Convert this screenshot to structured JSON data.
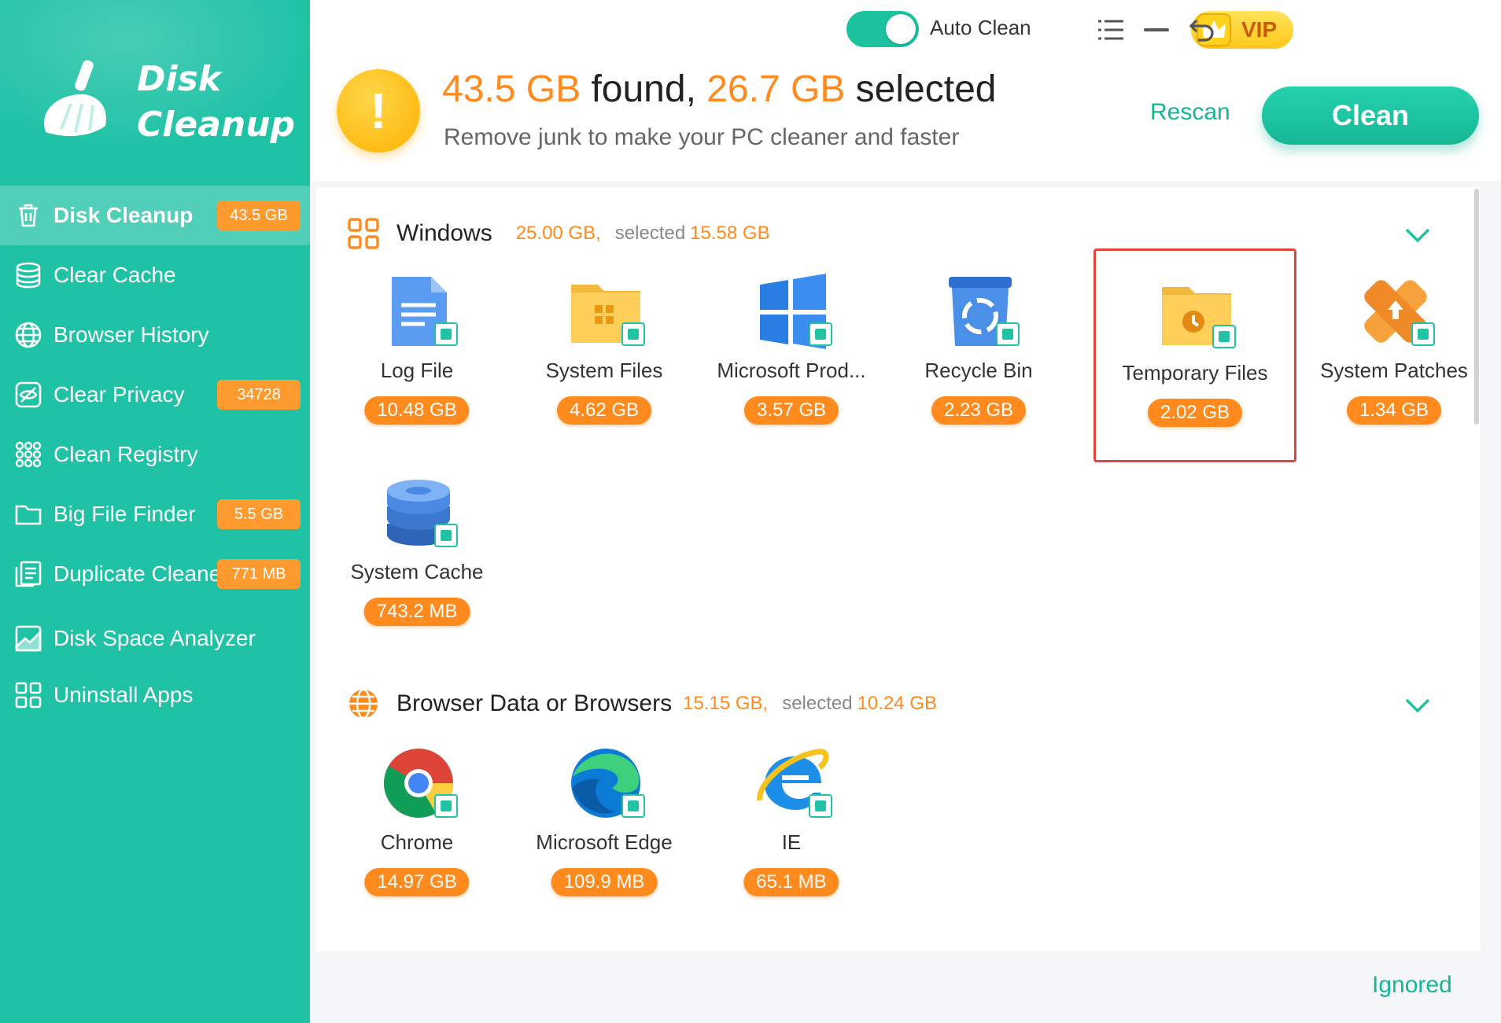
{
  "app": {
    "name_line1": "Disk",
    "name_line2": "Cleanup"
  },
  "colors": {
    "sidebar_bg": "#20c2a6",
    "accent_green": "#1cc29e",
    "orange": "#ff8a1e",
    "selection_border": "#e0463a"
  },
  "sidebar": {
    "items": [
      {
        "label": "Disk Cleanup",
        "badge": "43.5 GB",
        "icon": "trash-icon",
        "active": true
      },
      {
        "label": "Clear Cache",
        "badge": "",
        "icon": "database-icon"
      },
      {
        "label": "Browser History",
        "badge": "",
        "icon": "globe-icon"
      },
      {
        "label": "Clear Privacy",
        "badge": "34728",
        "icon": "eye-off-icon"
      },
      {
        "label": "Clean Registry",
        "badge": "",
        "icon": "grid-dots-icon"
      },
      {
        "label": "Big File Finder",
        "badge": "5.5 GB",
        "icon": "folder-icon"
      },
      {
        "label": "Duplicate Cleaner",
        "badge": "771 MB",
        "icon": "duplicate-icon"
      },
      {
        "label": "Disk Space Analyzer",
        "badge": "",
        "icon": "chart-icon"
      },
      {
        "label": "Uninstall Apps",
        "badge": "",
        "icon": "apps-icon"
      }
    ]
  },
  "topbar": {
    "auto_clean_label": "Auto Clean",
    "auto_clean_on": true,
    "vip_label": "VIP",
    "found_size": "43.5 GB",
    "found_word": " found, ",
    "selected_size": "26.7 GB",
    "selected_word": " selected",
    "subtitle": "Remove junk to make your PC cleaner and faster",
    "warning_glyph": "!",
    "rescan_label": "Rescan",
    "clean_label": "Clean"
  },
  "sections": {
    "windows": {
      "title": "Windows",
      "size": "25.00 GB",
      "sep": ",",
      "selected_label": "selected",
      "selected_size": "15.58 GB",
      "items": [
        {
          "name": "Log File",
          "size": "10.48 GB",
          "icon": "log-file-icon"
        },
        {
          "name": "System Files",
          "size": "4.62 GB",
          "icon": "system-files-icon"
        },
        {
          "name": "Microsoft Prod...",
          "size": "3.57 GB",
          "icon": "windows-logo-icon"
        },
        {
          "name": "Recycle Bin",
          "size": "2.23 GB",
          "icon": "recycle-bin-icon"
        },
        {
          "name": "Temporary Files",
          "size": "2.02 GB",
          "icon": "temp-folder-icon",
          "highlighted": true
        },
        {
          "name": "System Patches",
          "size": "1.34 GB",
          "icon": "patch-icon"
        },
        {
          "name": "System Cache",
          "size": "743.2 MB",
          "icon": "cache-disk-icon"
        }
      ]
    },
    "browsers": {
      "title": "Browser Data or Browsers",
      "size": "15.15 GB",
      "sep": ",",
      "selected_label": "selected",
      "selected_size": "10.24 GB",
      "items": [
        {
          "name": "Chrome",
          "size": "14.97 GB",
          "icon": "chrome-icon"
        },
        {
          "name": "Microsoft Edge",
          "size": "109.9 MB",
          "icon": "edge-icon"
        },
        {
          "name": "IE",
          "size": "65.1 MB",
          "icon": "ie-icon"
        }
      ]
    }
  },
  "footer": {
    "ignored_label": "Ignored"
  }
}
